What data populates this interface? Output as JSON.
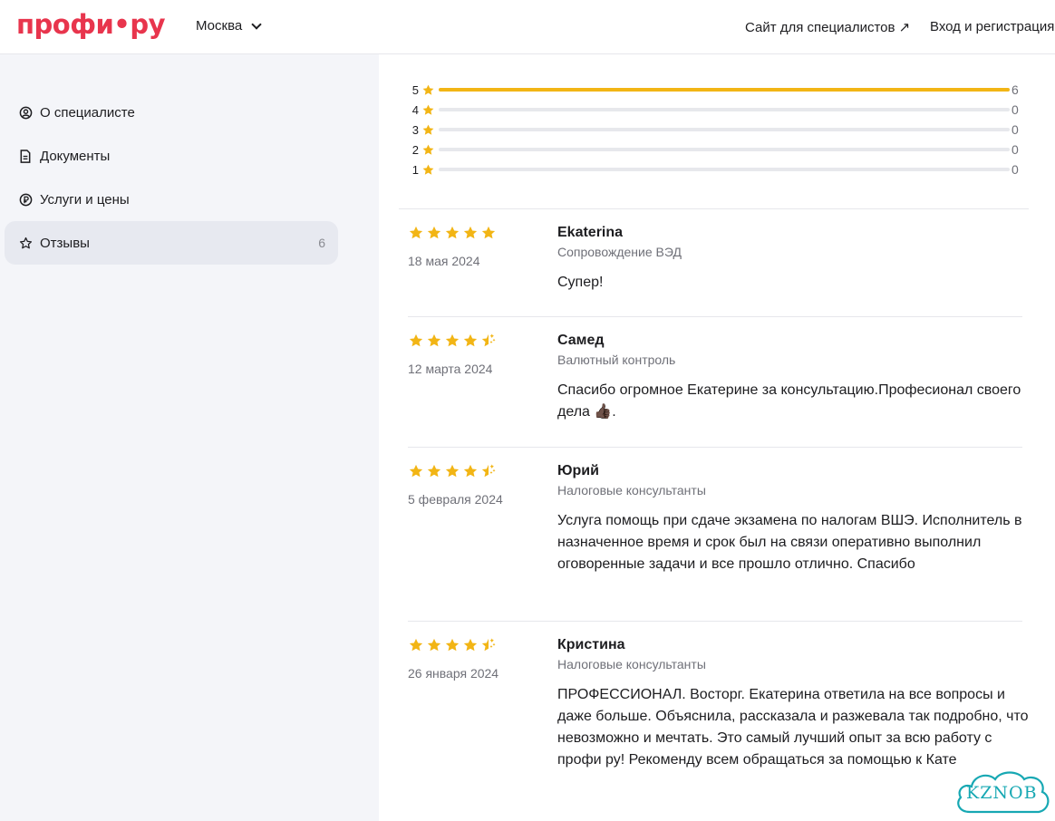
{
  "header": {
    "logo": "профи•ру",
    "city": "Москва",
    "for_specialists": "Сайт для специалистов ↗",
    "login": "Вход и регистрация"
  },
  "sidebar": {
    "items": [
      {
        "label": "О специалисте",
        "icon": "user-circle-icon"
      },
      {
        "label": "Документы",
        "icon": "document-icon"
      },
      {
        "label": "Услуги и цены",
        "icon": "ruble-icon"
      },
      {
        "label": "Отзывы",
        "icon": "star-outline-icon",
        "count": "6",
        "active": true
      }
    ]
  },
  "rating_distribution": [
    {
      "stars": "5",
      "count": "6",
      "fraction": 1.0
    },
    {
      "stars": "4",
      "count": "0",
      "fraction": 0
    },
    {
      "stars": "3",
      "count": "0",
      "fraction": 0
    },
    {
      "stars": "2",
      "count": "0",
      "fraction": 0
    },
    {
      "stars": "1",
      "count": "0",
      "fraction": 0
    }
  ],
  "reviews": [
    {
      "name": "Ekaterina",
      "category": "Сопровождение ВЭД",
      "date": "18 мая 2024",
      "rating": 5,
      "text": "Супер!"
    },
    {
      "name": "Самед",
      "category": "Валютный контроль",
      "date": "12 марта 2024",
      "rating": 4.5,
      "text": "Спасибо огромное Екатерине за консультацию.Професионал своего дела 👍🏿."
    },
    {
      "name": "Юрий",
      "category": "Налоговые консультанты",
      "date": "5 февраля 2024",
      "rating": 4.5,
      "text": "Услуга помощь при сдаче экзамена по налогам ВШЭ. Исполнитель в назначенное время и срок был на связи оперативно выполнил оговоренные задачи и все прошло отлично. Спасибо"
    },
    {
      "name": "Кристина",
      "category": "Налоговые консультанты",
      "date": "26 января 2024",
      "rating": 4.5,
      "text": "ПРОФЕССИОНАЛ. Восторг. Екатерина ответила на все вопросы и даже больше. Объяснила, рассказала и разжевала так подробно, что невозможно и мечтать. Это самый лучший опыт за всю работу с профи ру! Рекоменду всем обращаться за помощью к Кате"
    }
  ],
  "watermark": "KZNOB",
  "colors": {
    "brand": "#e8354d",
    "star": "#f2b515",
    "muted": "#6f7078"
  }
}
